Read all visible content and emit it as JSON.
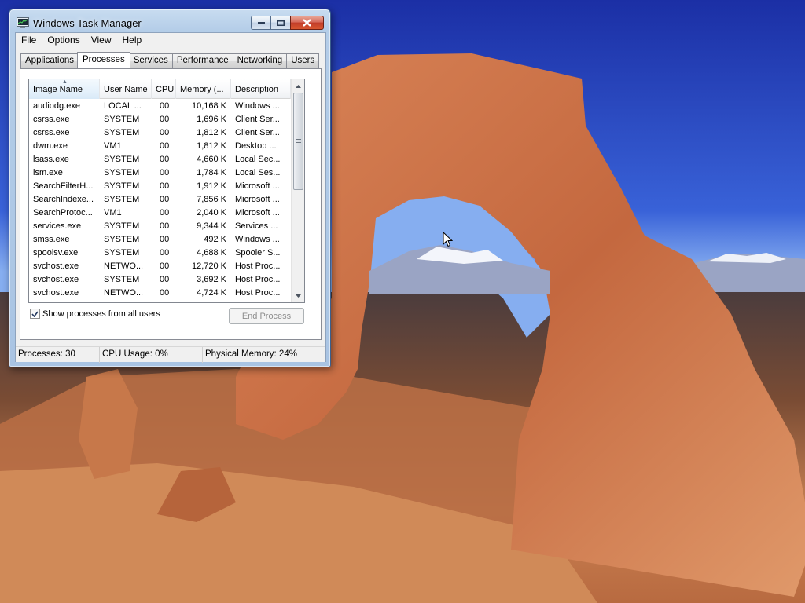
{
  "window": {
    "title": "Windows Task Manager"
  },
  "menu": [
    "File",
    "Options",
    "View",
    "Help"
  ],
  "tabs": [
    "Applications",
    "Processes",
    "Services",
    "Performance",
    "Networking",
    "Users"
  ],
  "active_tab": "Processes",
  "columns": [
    "Image Name",
    "User Name",
    "CPU",
    "Memory (...",
    "Description"
  ],
  "sort_column": "Image Name",
  "processes": [
    {
      "image": "audiodg.exe",
      "user": "LOCAL ...",
      "cpu": "00",
      "mem": "10,168 K",
      "desc": "Windows ..."
    },
    {
      "image": "csrss.exe",
      "user": "SYSTEM",
      "cpu": "00",
      "mem": "1,696 K",
      "desc": "Client Ser..."
    },
    {
      "image": "csrss.exe",
      "user": "SYSTEM",
      "cpu": "00",
      "mem": "1,812 K",
      "desc": "Client Ser..."
    },
    {
      "image": "dwm.exe",
      "user": "VM1",
      "cpu": "00",
      "mem": "1,812 K",
      "desc": "Desktop ..."
    },
    {
      "image": "lsass.exe",
      "user": "SYSTEM",
      "cpu": "00",
      "mem": "4,660 K",
      "desc": "Local Sec..."
    },
    {
      "image": "lsm.exe",
      "user": "SYSTEM",
      "cpu": "00",
      "mem": "1,784 K",
      "desc": "Local Ses..."
    },
    {
      "image": "SearchFilterH...",
      "user": "SYSTEM",
      "cpu": "00",
      "mem": "1,912 K",
      "desc": "Microsoft ..."
    },
    {
      "image": "SearchIndexe...",
      "user": "SYSTEM",
      "cpu": "00",
      "mem": "7,856 K",
      "desc": "Microsoft ..."
    },
    {
      "image": "SearchProtoc...",
      "user": "VM1",
      "cpu": "00",
      "mem": "2,040 K",
      "desc": "Microsoft ..."
    },
    {
      "image": "services.exe",
      "user": "SYSTEM",
      "cpu": "00",
      "mem": "9,344 K",
      "desc": "Services ..."
    },
    {
      "image": "smss.exe",
      "user": "SYSTEM",
      "cpu": "00",
      "mem": "492 K",
      "desc": "Windows ..."
    },
    {
      "image": "spoolsv.exe",
      "user": "SYSTEM",
      "cpu": "00",
      "mem": "4,688 K",
      "desc": "Spooler S..."
    },
    {
      "image": "svchost.exe",
      "user": "NETWO...",
      "cpu": "00",
      "mem": "12,720 K",
      "desc": "Host Proc..."
    },
    {
      "image": "svchost.exe",
      "user": "SYSTEM",
      "cpu": "00",
      "mem": "3,692 K",
      "desc": "Host Proc..."
    },
    {
      "image": "svchost.exe",
      "user": "NETWO...",
      "cpu": "00",
      "mem": "4,724 K",
      "desc": "Host Proc..."
    }
  ],
  "show_all_users": {
    "label": "Show processes from all users",
    "checked": true
  },
  "end_process_label": "End Process",
  "status": {
    "processes": "Processes: 30",
    "cpu": "CPU Usage: 0%",
    "memory": "Physical Memory: 24%"
  },
  "colors": {
    "close_button": "#c23d29",
    "window_frame": "#a9c4e3",
    "disabled_text": "#8d8d8d"
  },
  "icons": [
    "task-manager-app-icon",
    "minimize-icon",
    "maximize-icon",
    "close-icon",
    "sort-ascending-icon",
    "scroll-up-icon",
    "scroll-down-icon",
    "checkmark-icon",
    "mouse-cursor-icon"
  ]
}
